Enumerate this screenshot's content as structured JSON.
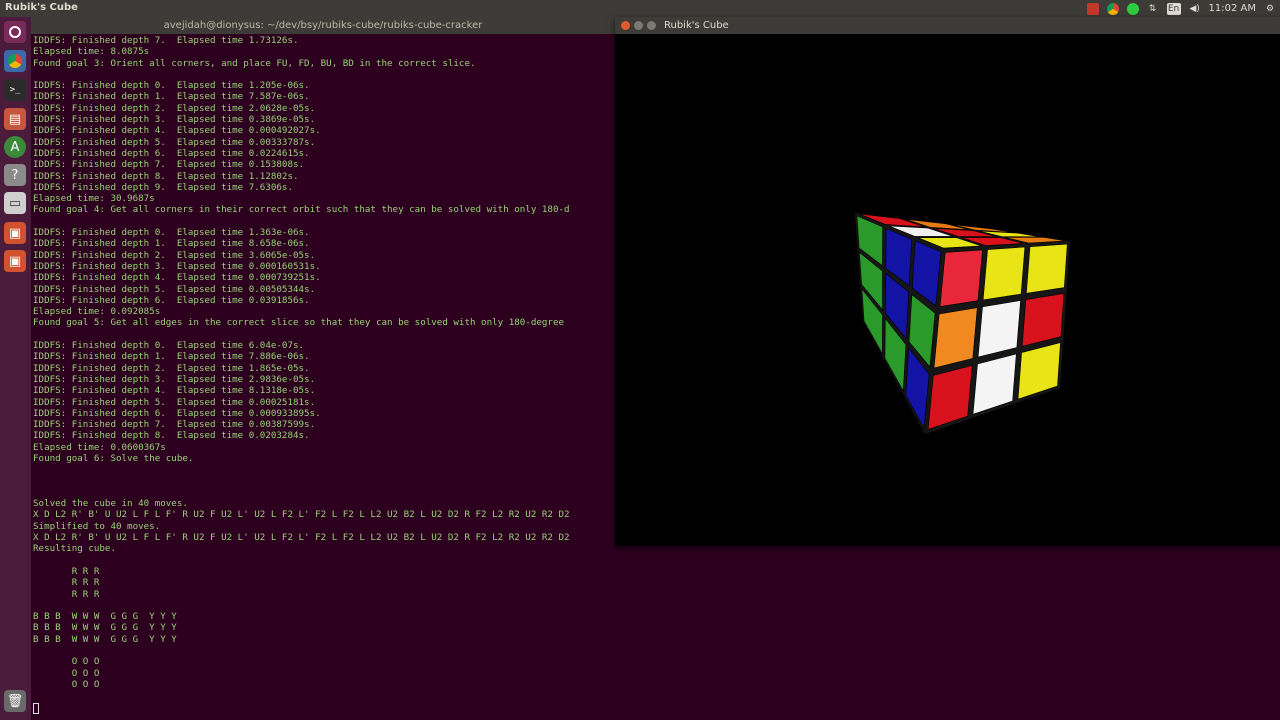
{
  "top_panel": {
    "app_title": "Rubik's Cube",
    "clock": "11:02 AM",
    "tray_icons": [
      "camera-icon",
      "chrome-icon",
      "status-icon",
      "network-icon",
      "keyboard-layout-icon",
      "volume-icon",
      "gear-icon"
    ],
    "keyboard_layout": "En"
  },
  "launcher": {
    "items": [
      "ubuntu-dash-icon",
      "chrome-icon",
      "terminal-icon",
      "files-icon",
      "software-updater-icon",
      "help-icon",
      "drive-icon",
      "software-center-icon",
      "software-center-icon-2",
      "trash-icon"
    ]
  },
  "terminal": {
    "title": "avejidah@dionysus: ~/dev/bsy/rubiks-cube/rubiks-cube-cracker",
    "lines": [
      "IDDFS: Finished depth 7.  Elapsed time 1.73126s.",
      "Elapsed time: 8.0875s",
      "Found goal 3: Orient all corners, and place FU, FD, BU, BD in the correct slice.",
      "",
      "IDDFS: Finished depth 0.  Elapsed time 1.205e-06s.",
      "IDDFS: Finished depth 1.  Elapsed time 7.587e-06s.",
      "IDDFS: Finished depth 2.  Elapsed time 2.0628e-05s.",
      "IDDFS: Finished depth 3.  Elapsed time 0.3869e-05s.",
      "IDDFS: Finished depth 4.  Elapsed time 0.000492027s.",
      "IDDFS: Finished depth 5.  Elapsed time 0.00333787s.",
      "IDDFS: Finished depth 6.  Elapsed time 0.0224615s.",
      "IDDFS: Finished depth 7.  Elapsed time 0.153808s.",
      "IDDFS: Finished depth 8.  Elapsed time 1.12802s.",
      "IDDFS: Finished depth 9.  Elapsed time 7.6306s.",
      "Elapsed time: 30.9687s",
      "Found goal 4: Get all corners in their correct orbit such that they can be solved with only 180-d",
      "",
      "IDDFS: Finished depth 0.  Elapsed time 1.363e-06s.",
      "IDDFS: Finished depth 1.  Elapsed time 8.658e-06s.",
      "IDDFS: Finished depth 2.  Elapsed time 3.6065e-05s.",
      "IDDFS: Finished depth 3.  Elapsed time 0.000160531s.",
      "IDDFS: Finished depth 4.  Elapsed time 0.000739251s.",
      "IDDFS: Finished depth 5.  Elapsed time 0.00505344s.",
      "IDDFS: Finished depth 6.  Elapsed time 0.0391856s.",
      "Elapsed time: 0.092085s",
      "Found goal 5: Get all edges in the correct slice so that they can be solved with only 180-degree",
      "",
      "IDDFS: Finished depth 0.  Elapsed time 6.04e-07s.",
      "IDDFS: Finished depth 1.  Elapsed time 7.886e-06s.",
      "IDDFS: Finished depth 2.  Elapsed time 1.865e-05s.",
      "IDDFS: Finished depth 3.  Elapsed time 2.9836e-05s.",
      "IDDFS: Finished depth 4.  Elapsed time 8.1318e-05s.",
      "IDDFS: Finished depth 5.  Elapsed time 0.00025181s.",
      "IDDFS: Finished depth 6.  Elapsed time 0.000933895s.",
      "IDDFS: Finished depth 7.  Elapsed time 0.00387599s.",
      "IDDFS: Finished depth 8.  Elapsed time 0.0203284s.",
      "Elapsed time: 0.0600367s",
      "Found goal 6: Solve the cube.",
      "",
      "",
      "",
      "Solved the cube in 40 moves.",
      "X D L2 R' B' U U2 L F L F' R U2 F U2 L' U2 L F2 L' F2 L F2 L L2 U2 B2 L U2 D2 R F2 L2 R2 U2 R2 D2",
      "Simplified to 40 moves.",
      "X D L2 R' B' U U2 L F L F' R U2 F U2 L' U2 L F2 L' F2 L F2 L L2 U2 B2 L U2 D2 R F2 L2 R2 U2 R2 D2",
      "Resulting cube.",
      "",
      "       R R R",
      "       R R R",
      "       R R R",
      "",
      "B B B  W W W  G G G  Y Y Y",
      "B B B  W W W  G G G  Y Y Y",
      "B B B  W W W  G G G  Y Y Y",
      "",
      "       O O O",
      "       O O O",
      "       O O O"
    ]
  },
  "rubik_window": {
    "title": "Rubik's Cube",
    "cube": {
      "top": [
        [
          "#d8121c",
          "#e87a12",
          "#e87a12"
        ],
        [
          "#f0f0f0",
          "#d8121c",
          "#e8e415"
        ],
        [
          "#e8e415",
          "#d8121c",
          "#e87a12"
        ]
      ],
      "left": [
        [
          "#2a9b2a",
          "#1313a5",
          "#1313a5"
        ],
        [
          "#2a9b2a",
          "#1313a5",
          "#2a9b2a"
        ],
        [
          "#2a9b2a",
          "#2a9b2a",
          "#1313a5"
        ]
      ],
      "right": [
        [
          "#e8283a",
          "#e8e415",
          "#e8e415"
        ],
        [
          "#f08a20",
          "#f4f4f4",
          "#d8121c"
        ],
        [
          "#d8121c",
          "#f4f4f4",
          "#e8e415"
        ]
      ]
    }
  }
}
